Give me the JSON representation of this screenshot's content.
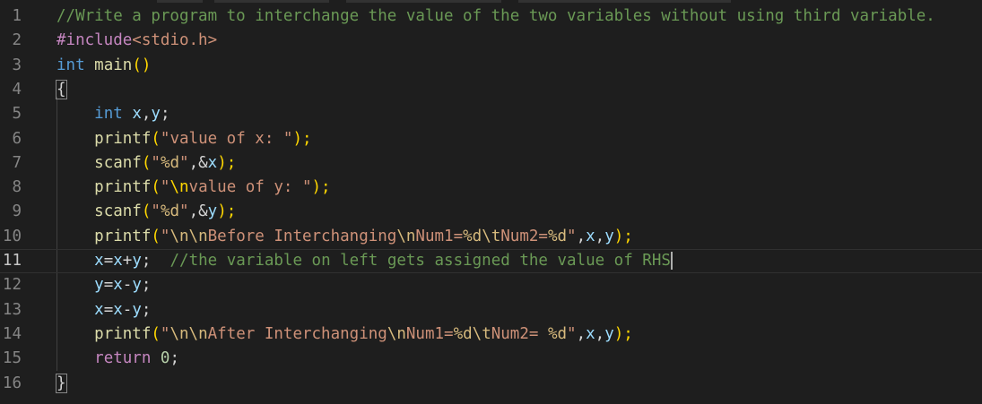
{
  "editor": {
    "lines": [
      {
        "no": "1",
        "t": [
          "//Write a program to interchange the value of the two variables without using third variable."
        ]
      },
      {
        "no": "2",
        "t": [
          "#include",
          "<stdio.h>"
        ]
      },
      {
        "no": "3",
        "t": [
          "int",
          " ",
          "main",
          "()"
        ]
      },
      {
        "no": "4",
        "t": [
          "{"
        ]
      },
      {
        "no": "5",
        "t": [
          "    ",
          "int",
          " ",
          "x",
          ",",
          "y",
          ";"
        ]
      },
      {
        "no": "6",
        "t": [
          "    ",
          "printf",
          "(",
          "\"value of x: \"",
          ");"
        ]
      },
      {
        "no": "7",
        "t": [
          "    ",
          "scanf",
          "(",
          "\"",
          "%d",
          "\"",
          ",&",
          "x",
          ");"
        ]
      },
      {
        "no": "8",
        "t": [
          "    ",
          "printf",
          "(",
          "\"",
          "\\n",
          "value of y: \"",
          ");"
        ]
      },
      {
        "no": "9",
        "t": [
          "    ",
          "scanf",
          "(",
          "\"",
          "%d",
          "\"",
          ",&",
          "y",
          ");"
        ]
      },
      {
        "no": "10",
        "t": [
          "    ",
          "printf",
          "(",
          "\"",
          "\\n\\n",
          "Before Interchanging",
          "\\n",
          "Num1=",
          "%d",
          "\\t",
          "Num2=",
          "%d",
          "\"",
          ",",
          "x",
          ",",
          "y",
          ");"
        ]
      },
      {
        "no": "11",
        "t": [
          "    ",
          "x",
          "=",
          "x",
          "+",
          "y",
          ";  ",
          "//the variable on left gets assigned the value of RHS"
        ]
      },
      {
        "no": "12",
        "t": [
          "    ",
          "y",
          "=",
          "x",
          "-",
          "y",
          ";"
        ]
      },
      {
        "no": "13",
        "t": [
          "    ",
          "x",
          "=",
          "x",
          "-",
          "y",
          ";"
        ]
      },
      {
        "no": "14",
        "t": [
          "    ",
          "printf",
          "(",
          "\"",
          "\\n\\n",
          "After Interchanging",
          "\\n",
          "Num1=",
          "%d",
          "\\t",
          "Num2= ",
          "%d",
          "\"",
          ",",
          "x",
          ",",
          "y",
          ");"
        ]
      },
      {
        "no": "15",
        "t": [
          "    ",
          "return",
          " ",
          "0",
          ";"
        ]
      },
      {
        "no": "16",
        "t": [
          "}"
        ]
      }
    ],
    "colors": {
      "background": "#1e1e1e",
      "comment": "#6a9955",
      "keyword": "#569cd6",
      "function": "#dcdcaa",
      "variable": "#9cdcfe",
      "string": "#ce9178",
      "escape": "#d7ba7d",
      "number": "#b5cea8",
      "control": "#c586c0"
    }
  }
}
